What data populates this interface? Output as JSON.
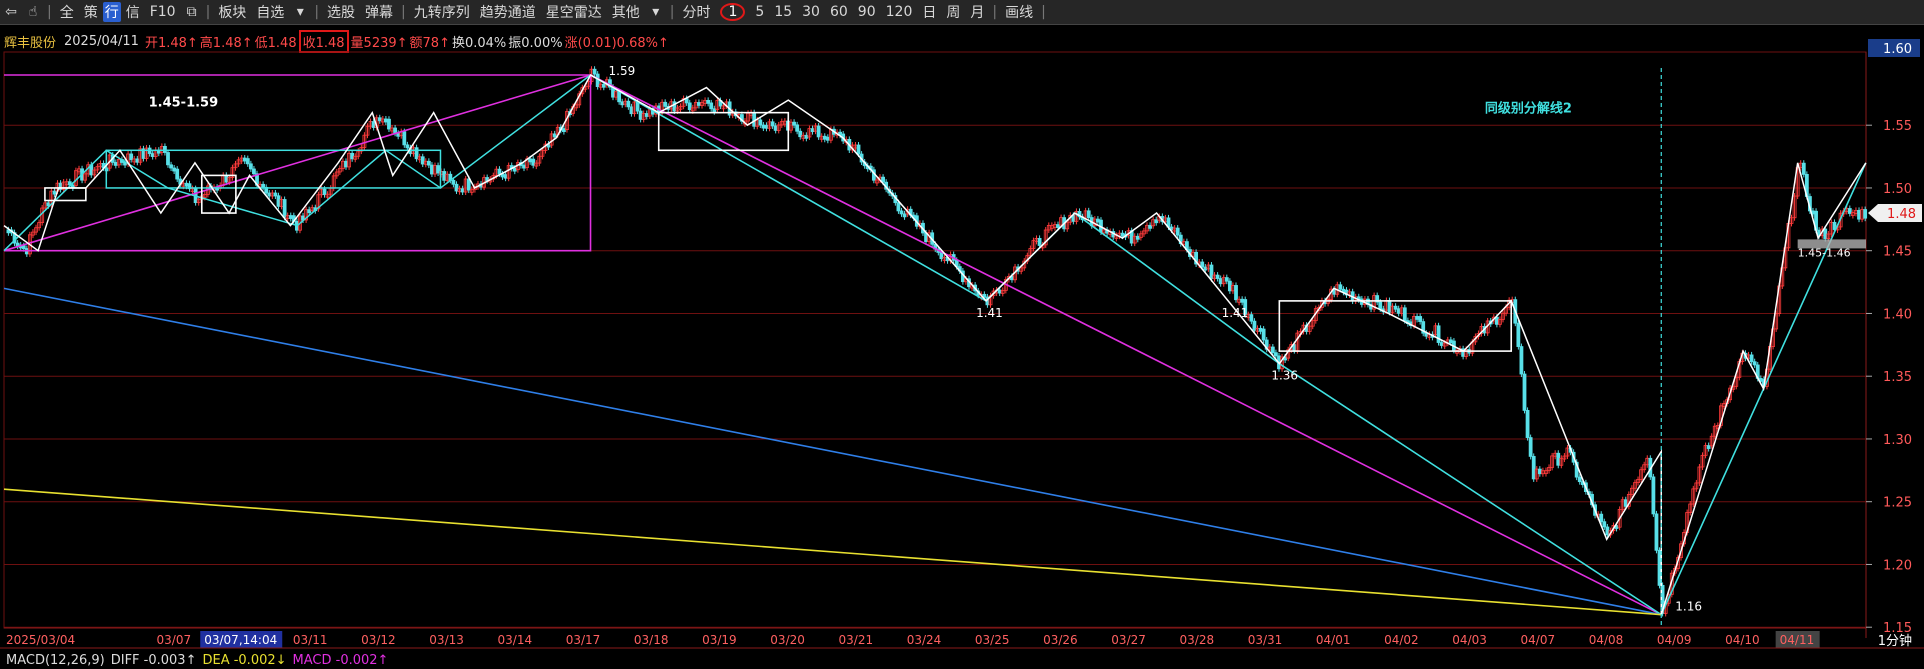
{
  "toolbar": {
    "items": [
      "全",
      "策",
      "信",
      "板块",
      "自选",
      "选股",
      "弹幕",
      "九转序列",
      "趋势通道",
      "星空雷达",
      "其他",
      "分时",
      "1",
      "5",
      "15",
      "30",
      "60",
      "90",
      "120",
      "日",
      "周",
      "月",
      "画线"
    ],
    "f10": "F10",
    "row_icon": "行"
  },
  "info": {
    "stock_name": "辉丰股份",
    "date": "2025/04/11",
    "open": "开1.48↑",
    "high": "高1.48↑",
    "low": "低1.48",
    "close": "收1.48",
    "volume": "量5239↑",
    "amount": "额78↑",
    "turnover": "换0.04%",
    "amplitude": "振0.00%",
    "change": "涨(0.01)0.68%↑"
  },
  "macd": {
    "title": "MACD(12,26,9)",
    "diff": "DIFF -0.003↑",
    "dea": "DEA -0.002↓",
    "macd": "MACD -0.002↑"
  },
  "colors": {
    "up": "#ff3b3b",
    "down": "#58e0e8",
    "grid": "#6e1010",
    "magenta": "#e030e0",
    "cyan": "#40e0e0",
    "blue": "#2f7fe8",
    "yellow": "#e8e030",
    "white": "#ffffff",
    "background": "#000000"
  },
  "chart_data": {
    "type": "candlestick",
    "period": "1分钟",
    "ylim": [
      1.15,
      1.6
    ],
    "yticks": [
      "1.55",
      "1.50",
      "1.45",
      "1.40",
      "1.35",
      "1.30",
      "1.25",
      "1.20",
      "1.15"
    ],
    "ytop_label": "1.60",
    "current_price_tag": "1.48",
    "x_dates": [
      "2025/03/04",
      "03/07",
      "03/07,14:04",
      "03/11",
      "03/12",
      "03/13",
      "03/14",
      "03/17",
      "03/18",
      "03/19",
      "03/20",
      "03/21",
      "03/24",
      "03/25",
      "03/26",
      "03/27",
      "03/28",
      "03/31",
      "04/01",
      "04/02",
      "04/03",
      "04/07",
      "04/08",
      "04/09",
      "04/10",
      "04/11"
    ],
    "date_positions": [
      0,
      2.5,
      3.2,
      4.5,
      5.5,
      6.5,
      7.5,
      8.5,
      9.5,
      10.5,
      11.5,
      12.5,
      13.5,
      14.5,
      15.5,
      16.5,
      17.5,
      18.5,
      19.5,
      20.5,
      21.5,
      22.5,
      23.5,
      24.5,
      25.5,
      26.3
    ],
    "price_path": [
      [
        0,
        1.47
      ],
      [
        0.3,
        1.45
      ],
      [
        0.7,
        1.5
      ],
      [
        1.5,
        1.52
      ],
      [
        2.3,
        1.53
      ],
      [
        2.8,
        1.49
      ],
      [
        3.5,
        1.52
      ],
      [
        4.3,
        1.47
      ],
      [
        5.0,
        1.52
      ],
      [
        5.5,
        1.56
      ],
      [
        6.0,
        1.53
      ],
      [
        6.6,
        1.5
      ],
      [
        7.2,
        1.51
      ],
      [
        7.8,
        1.52
      ],
      [
        8.3,
        1.56
      ],
      [
        8.6,
        1.59
      ],
      [
        9.3,
        1.56
      ],
      [
        10.3,
        1.57
      ],
      [
        11.2,
        1.55
      ],
      [
        12.3,
        1.54
      ],
      [
        13.2,
        1.48
      ],
      [
        14.4,
        1.41
      ],
      [
        15.2,
        1.46
      ],
      [
        15.7,
        1.48
      ],
      [
        16.5,
        1.46
      ],
      [
        16.9,
        1.48
      ],
      [
        17.5,
        1.44
      ],
      [
        18.0,
        1.42
      ],
      [
        18.7,
        1.36
      ],
      [
        19.5,
        1.42
      ],
      [
        20.5,
        1.4
      ],
      [
        21.4,
        1.37
      ],
      [
        22.1,
        1.41
      ],
      [
        22.4,
        1.27
      ],
      [
        22.9,
        1.29
      ],
      [
        23.5,
        1.22
      ],
      [
        24.1,
        1.29
      ],
      [
        24.3,
        1.16
      ],
      [
        24.8,
        1.27
      ],
      [
        25.5,
        1.37
      ],
      [
        25.8,
        1.34
      ],
      [
        26.3,
        1.52
      ],
      [
        26.6,
        1.46
      ],
      [
        27.0,
        1.48
      ],
      [
        27.3,
        1.48
      ]
    ],
    "annotations": [
      {
        "text": "1.59",
        "at": [
          8.6,
          1.59
        ]
      },
      {
        "text": "1.45-1.59",
        "at": [
          3.0,
          1.565
        ]
      },
      {
        "text": "1.41",
        "at": [
          14.4,
          1.41
        ]
      },
      {
        "text": "1.41",
        "at": [
          18.0,
          1.41
        ]
      },
      {
        "text": "1.36",
        "at": [
          18.7,
          1.36
        ]
      },
      {
        "text": "1.16",
        "at": [
          24.3,
          1.16
        ]
      },
      {
        "text": "1.45-1.46",
        "at": [
          26.3,
          1.455
        ]
      },
      {
        "text": "同级别分解线2",
        "at": [
          23.4,
          1.56
        ]
      }
    ]
  }
}
